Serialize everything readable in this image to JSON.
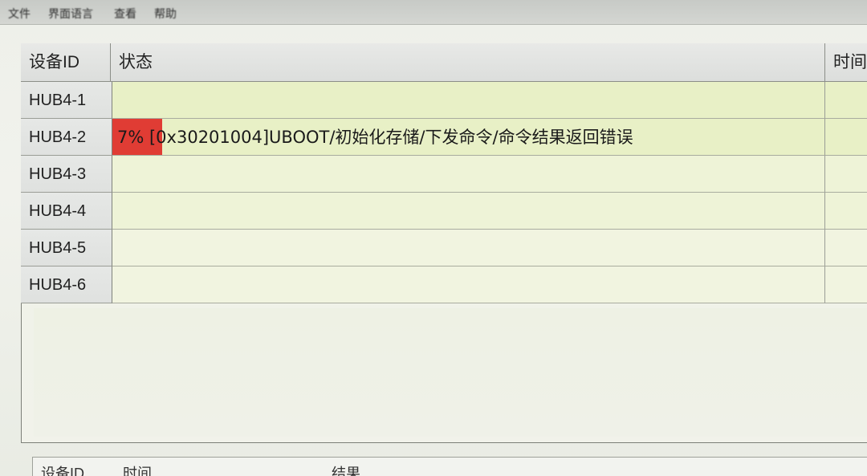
{
  "menu": {
    "file": "文件",
    "language": "界面语言",
    "view": "查看",
    "help": "帮助"
  },
  "table": {
    "headers": {
      "device_id": "设备ID",
      "status": "状态",
      "time": "时间"
    },
    "rows": [
      {
        "device_id": "HUB4-1",
        "status": "",
        "progress_percent": 0
      },
      {
        "device_id": "HUB4-2",
        "status": "7% [0x30201004]UBOOT/初始化存储/下发命令/命令结果返回错误",
        "progress_percent": 7
      },
      {
        "device_id": "HUB4-3",
        "status": "",
        "progress_percent": 0
      },
      {
        "device_id": "HUB4-4",
        "status": "",
        "progress_percent": 0
      },
      {
        "device_id": "HUB4-5",
        "status": "",
        "progress_percent": 0
      },
      {
        "device_id": "HUB4-6",
        "status": "",
        "progress_percent": 0
      }
    ]
  },
  "log": {
    "headers": {
      "device_id": "设备ID",
      "time": "时间",
      "result": "结果"
    }
  },
  "colors": {
    "progress_error": "#e03c34",
    "status_bg": "#e8f0c6"
  }
}
